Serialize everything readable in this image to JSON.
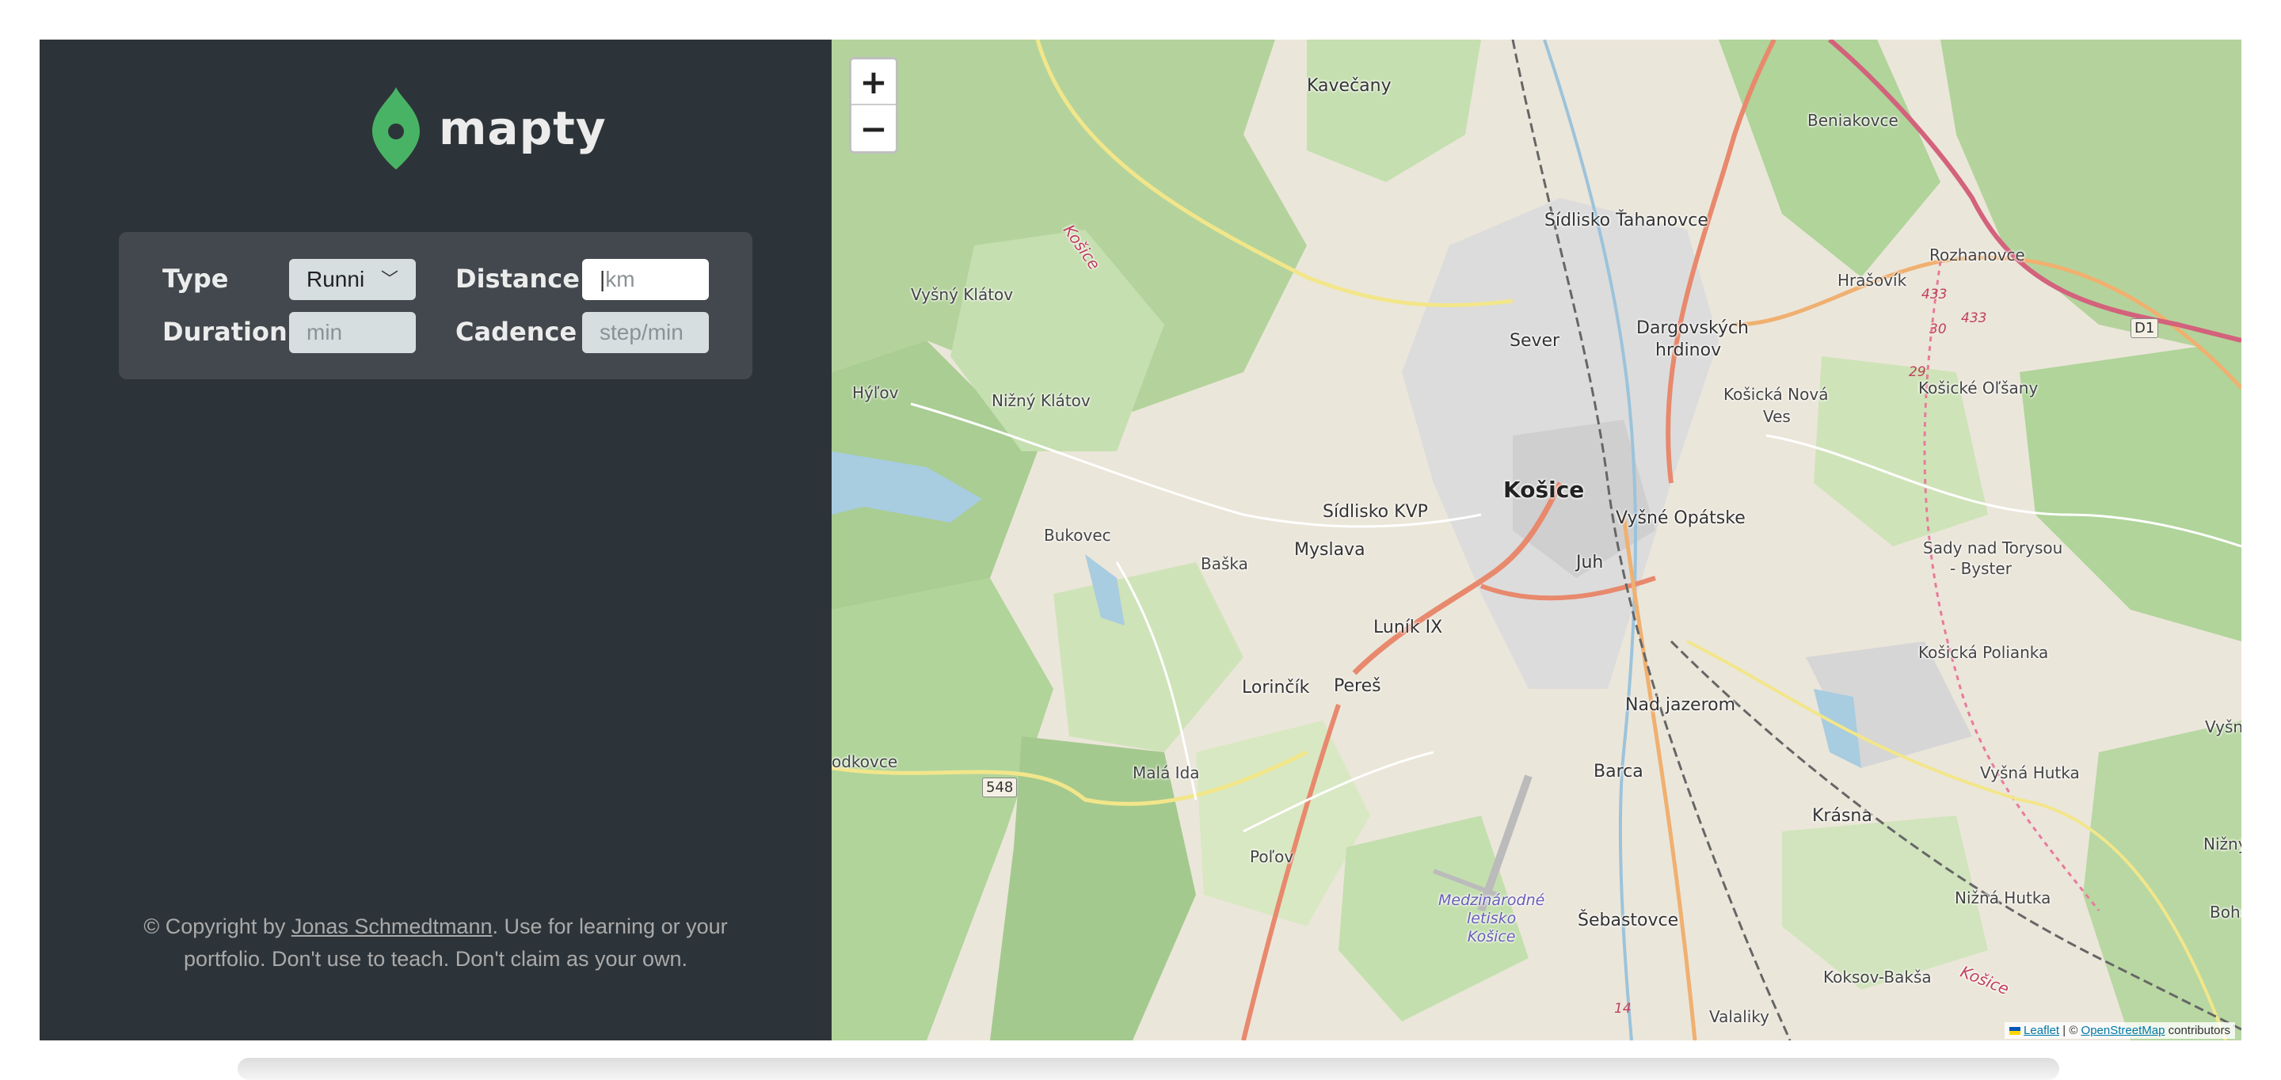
{
  "brand": {
    "name": "mapty",
    "logo_color": "#49b365"
  },
  "form": {
    "type_label": "Type",
    "type_value": "Runni",
    "distance_label": "Distance",
    "distance_placeholder": "km",
    "duration_label": "Duration",
    "duration_placeholder": "min",
    "cadence_label": "Cadence",
    "cadence_placeholder": "step/min"
  },
  "credits": {
    "prefix": "© Copyright by ",
    "author": "Jonas Schmedtmann",
    "suffix_line1": ". Use for learning or your",
    "line2": "portfolio. Don't use to teach. Don't claim as your own."
  },
  "map": {
    "zoom_in": "+",
    "zoom_out": "−",
    "attribution_leaflet": "Leaflet",
    "attribution_sep": " | © ",
    "attribution_osm": "OpenStreetMap",
    "attribution_suffix": " contributors",
    "places": {
      "kavecany": "Kavečany",
      "beniakovce": "Beniakovce",
      "sidlisko_tahanovce": "Sídlisko Ťahanovce",
      "rozhanovce": "Rozhanovce",
      "hrasovik": "Hrašovík",
      "vysny_klatov": "Vyšný Klátov",
      "sever": "Sever",
      "dargovskych": "Dargovských",
      "hrdinov": "hrdinov",
      "kosicka_nova": "Košická Nová",
      "ves": "Ves",
      "kosicke_olsany": "Košické Oľšany",
      "hylov": "Hýľov",
      "nizny_klatov": "Nižný Klátov",
      "kosice": "Košice",
      "sidlisko_kvp": "Sídlisko KVP",
      "vysne_opatske": "Vyšné Opátske",
      "bukovec": "Bukovec",
      "myslava": "Myslava",
      "baska": "Baška",
      "juh": "Juh",
      "sady": "Sady nad Torysou",
      "byster": "- Byster",
      "lunik": "Luník IX",
      "kosicka_polianka": "Košická Polianka",
      "lorincik": "Lorinčík",
      "peres": "Pereš",
      "nad_jazerom": "Nad jazerom",
      "vysny": "Vyšný",
      "podkovce": "odkovce",
      "mala_ida": "Malá Ida",
      "barca": "Barca",
      "vysna_hutka": "Vyšná Hutka",
      "krasna": "Krásna",
      "nizny": "Nižný",
      "polov": "Poľov",
      "medz1": "Medzinárodné",
      "medz2": "letisko",
      "medz3": "Košice",
      "sebastovce": "Šebastovce",
      "nizna_hutka": "Nižná Hutka",
      "bohdan": "Bohdan",
      "koksov": "Koksov-Bakša",
      "valaliky": "Valaliky",
      "kosice_rail": "Košice",
      "kosice_stream": "Košice"
    },
    "road_labels": {
      "r548": "548",
      "d1": "D1",
      "r433a": "433",
      "r433b": "433",
      "r30": "30",
      "r29": "29",
      "r14": "14"
    }
  }
}
